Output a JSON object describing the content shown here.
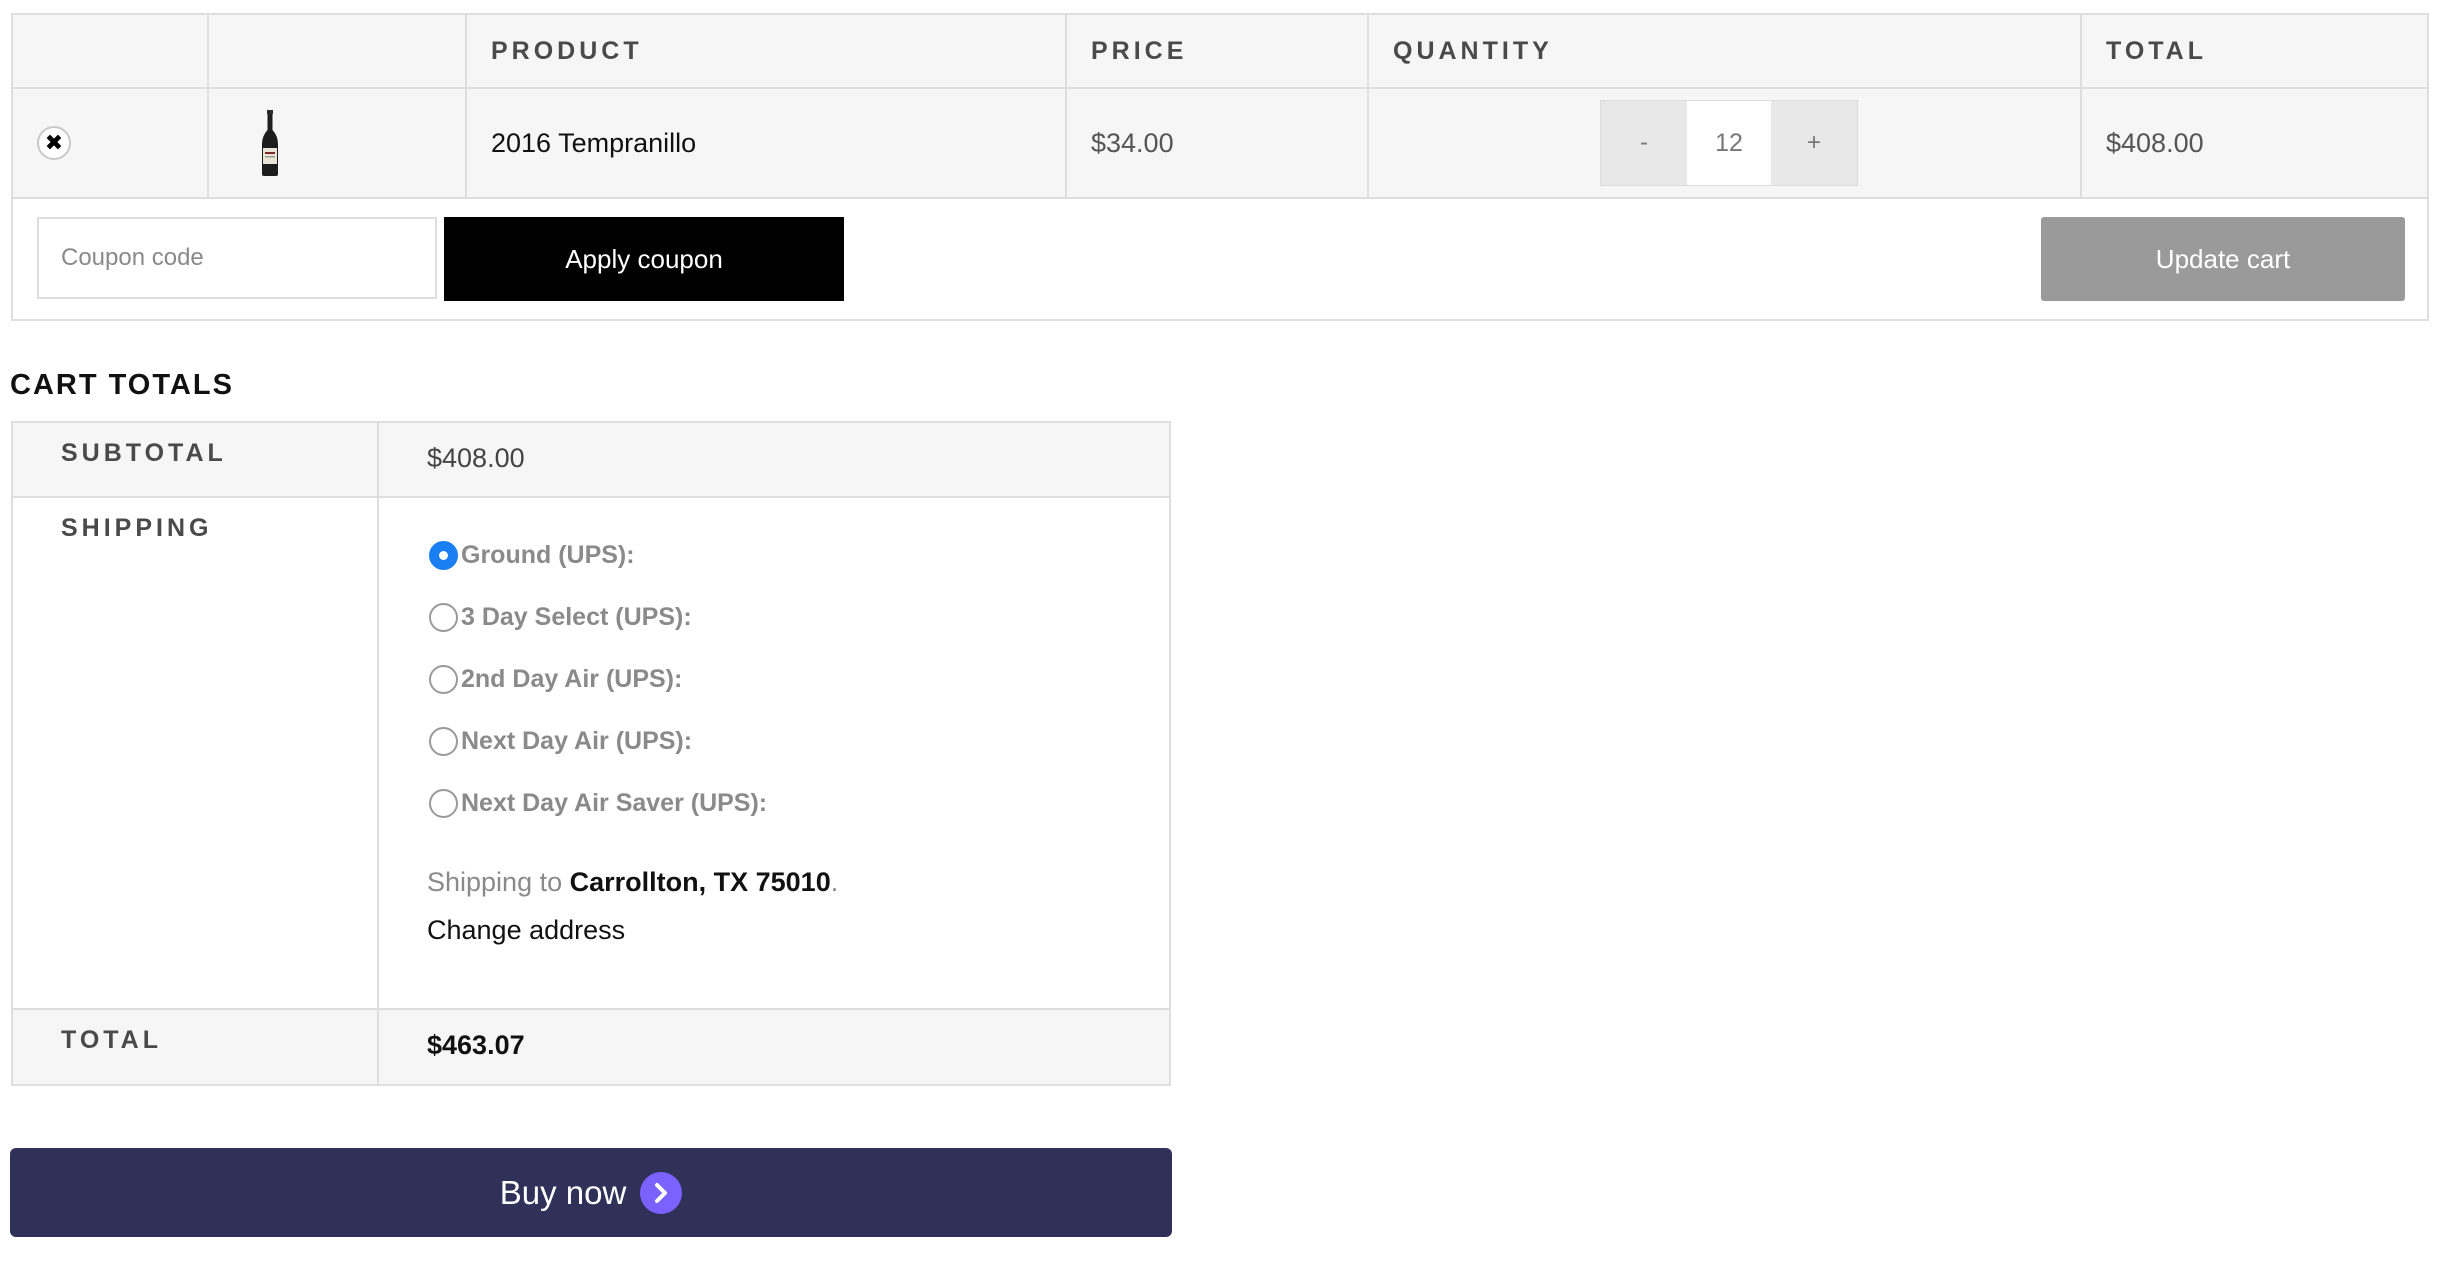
{
  "cart": {
    "headers": {
      "remove": "",
      "thumbnail": "",
      "product": "PRODUCT",
      "price": "PRICE",
      "quantity": "QUANTITY",
      "total": "TOTAL"
    },
    "items": [
      {
        "remove_icon": "close-icon",
        "thumbnail_icon": "wine-bottle-icon",
        "product": "2016 Tempranillo",
        "price": "$34.00",
        "quantity_decrement": "-",
        "quantity": "12",
        "quantity_increment": "+",
        "total": "$408.00"
      }
    ],
    "actions": {
      "coupon_placeholder": "Coupon code",
      "apply_coupon_label": "Apply coupon",
      "update_cart_label": "Update cart"
    }
  },
  "cart_totals": {
    "title": "CART TOTALS",
    "subtotal_label": "SUBTOTAL",
    "subtotal_value": "$408.00",
    "shipping_label": "SHIPPING",
    "shipping_options": [
      {
        "label": "Ground (UPS):",
        "selected": true
      },
      {
        "label": "3 Day Select (UPS):",
        "selected": false
      },
      {
        "label": "2nd Day Air (UPS):",
        "selected": false
      },
      {
        "label": "Next Day Air (UPS):",
        "selected": false
      },
      {
        "label": "Next Day Air Saver (UPS):",
        "selected": false
      }
    ],
    "shipping_to_prefix": "Shipping to",
    "shipping_to_address": "Carrollton, TX 75010",
    "shipping_to_suffix": ".",
    "change_address_label": "Change address",
    "total_label": "TOTAL",
    "total_value": "$463.07"
  },
  "buy_now": {
    "label": "Buy now",
    "icon": "chevron-right-icon"
  },
  "colors": {
    "selected_radio": "#1a7ff2",
    "apply_button": "#000000",
    "update_button": "#9a9a9a",
    "buy_now_button": "#2f3159",
    "buy_now_icon": "#7b61ff"
  }
}
